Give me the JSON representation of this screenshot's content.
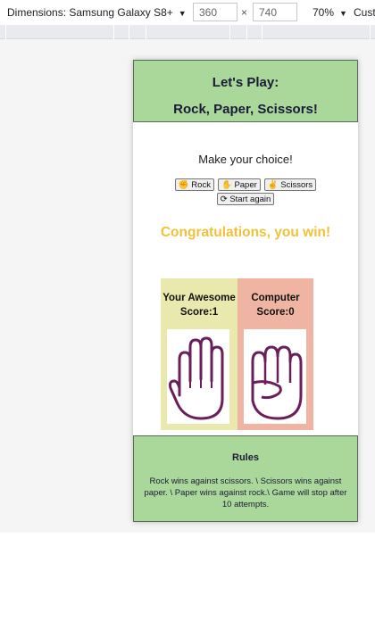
{
  "devtools": {
    "device_label": "Dimensions: Samsung Galaxy S8+",
    "width_value": "360",
    "height_value": "740",
    "times": "×",
    "zoom": "70%",
    "more": "Cust"
  },
  "game": {
    "title_line1": "Let's Play:",
    "title_line2": "Rock, Paper, Scissors!",
    "prompt": "Make your choice!",
    "buttons": {
      "rock": "Rock",
      "paper": "Paper",
      "scissors": "Scissors",
      "restart": "Start again"
    },
    "result": "Congratulations, you win!",
    "player": {
      "label": "Your Awesome Score:1",
      "hand": "paper-hand-icon"
    },
    "computer": {
      "label": "Computer Score:0",
      "hand": "rock-hand-icon"
    },
    "rules_title": "Rules",
    "rules_text": "Rock wins against scissors. \\ Scissors wins against paper. \\ Paper wins against rock.\\ Game will stop after 10 attempts."
  },
  "colors": {
    "header_green": "#aad79a",
    "result_yellow": "#f0c23a",
    "player_panel": "#e9e8ad",
    "computer_panel": "#f0b5a2",
    "hand_outline": "#6a1e5a"
  }
}
